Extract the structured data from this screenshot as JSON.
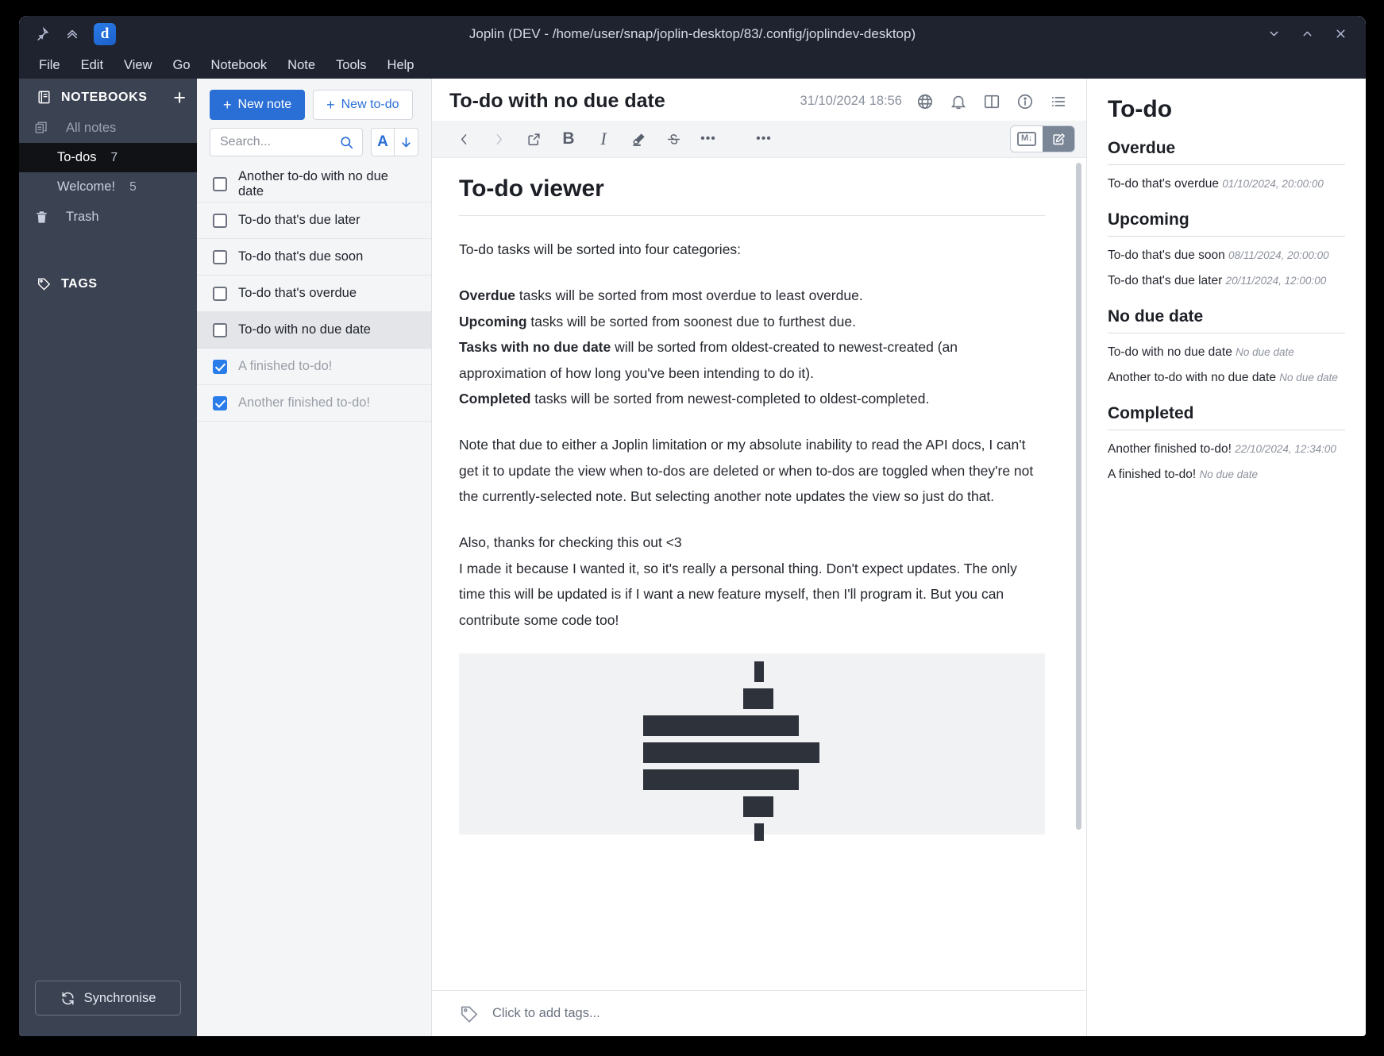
{
  "window": {
    "title": "Joplin (DEV - /home/user/snap/joplin-desktop/83/.config/joplindev-desktop)",
    "pin_icon": "pin-icon",
    "collapse_icon": "chevron-double-up-icon",
    "app_logo": "joplin-logo",
    "minimize_icon": "chevron-down-icon",
    "maximize_icon": "chevron-up-icon",
    "close_icon": "close-icon"
  },
  "menu": {
    "items": [
      {
        "label": "File"
      },
      {
        "label": "Edit"
      },
      {
        "label": "View"
      },
      {
        "label": "Go"
      },
      {
        "label": "Notebook"
      },
      {
        "label": "Note"
      },
      {
        "label": "Tools"
      },
      {
        "label": "Help"
      }
    ]
  },
  "sidebar": {
    "notebooks_header": "NOTEBOOKS",
    "notebooks_icon": "notebook-icon",
    "add_icon": "plus-icon",
    "items": [
      {
        "label": "All notes",
        "count": "",
        "icon": "all-notes-icon",
        "selected": false,
        "dim": true
      },
      {
        "label": "To-dos",
        "count": "7",
        "icon": "",
        "selected": true,
        "dim": false
      },
      {
        "label": "Welcome!",
        "count": "5",
        "icon": "",
        "selected": false,
        "dim": false
      },
      {
        "label": "Trash",
        "count": "",
        "icon": "trash-icon",
        "selected": false,
        "dim": false
      }
    ],
    "tags_header": "TAGS",
    "tags_icon": "tag-icon",
    "sync_label": "Synchronise",
    "sync_icon": "sync-icon"
  },
  "notelist": {
    "new_note_label": "New note",
    "new_todo_label": "New to-do",
    "search_placeholder": "Search...",
    "search_icon": "search-icon",
    "sort_field_label": "A",
    "sort_direction_icon": "arrow-down-icon",
    "items": [
      {
        "title": "Another to-do with no due date",
        "checked": false,
        "selected": false
      },
      {
        "title": "To-do that's due later",
        "checked": false,
        "selected": false
      },
      {
        "title": "To-do that's due soon",
        "checked": false,
        "selected": false
      },
      {
        "title": "To-do that's overdue",
        "checked": false,
        "selected": false
      },
      {
        "title": "To-do with no due date",
        "checked": false,
        "selected": true
      },
      {
        "title": "A finished to-do!",
        "checked": true,
        "selected": false
      },
      {
        "title": "Another finished to-do!",
        "checked": true,
        "selected": false
      }
    ]
  },
  "editor": {
    "note_title": "To-do with no due date",
    "updated": "31/10/2024 18:56",
    "header_icons": [
      {
        "name": "globe-icon"
      },
      {
        "name": "alarm-icon"
      },
      {
        "name": "split-layout-icon"
      },
      {
        "name": "info-icon"
      },
      {
        "name": "list-menu-icon"
      }
    ],
    "toolbar": [
      {
        "name": "back-icon",
        "glyph": "‹",
        "disabled": false
      },
      {
        "name": "forward-icon",
        "glyph": "›",
        "disabled": true
      },
      {
        "name": "external-link-icon",
        "glyph": "",
        "disabled": false
      },
      {
        "name": "bold-icon",
        "glyph": "B",
        "disabled": false
      },
      {
        "name": "italic-icon",
        "glyph": "I",
        "disabled": false
      },
      {
        "name": "highlight-icon",
        "glyph": "",
        "disabled": false
      },
      {
        "name": "strikethrough-icon",
        "glyph": "S",
        "disabled": false
      },
      {
        "name": "more-options-icon",
        "glyph": "•••",
        "disabled": false
      },
      {
        "name": "more-plugins-icon",
        "glyph": "•••",
        "disabled": false
      }
    ],
    "markdown_toggle_label": "M",
    "editor_toggle_icon": "pencil-square-icon",
    "document": {
      "heading": "To-do viewer",
      "intro": "To-do tasks will be sorted into four categories:",
      "categories": [
        {
          "bold": "Overdue",
          "rest": " tasks will be sorted from most overdue to least overdue."
        },
        {
          "bold": "Upcoming",
          "rest": " tasks will be sorted from soonest due to furthest due."
        },
        {
          "bold": "Tasks with no due date",
          "rest": " will be sorted from oldest-created to newest-created (an approximation of how long you've been intending to do it)."
        },
        {
          "bold": "Completed",
          "rest": " tasks will be sorted from newest-completed to oldest-completed."
        }
      ],
      "paragraph2": "Note that due to either a Joplin limitation or my absolute inability to read the API docs, I can't get it to update the view when to-dos are deleted or when to-dos are toggled when they're not the currently-selected note. But selecting another note updates the view so just do that.",
      "paragraph3_line1": "Also, thanks for checking this out <3",
      "paragraph3_line2": "I made it because I wanted it, so it's really a personal thing. Don't expect updates. The only time this will be updated is if I want a new feature myself, then I'll program it. But you can contribute some code too!"
    },
    "tagbar_label": "Click to add tags...",
    "tagbar_icon": "tag-icon"
  },
  "todo_panel": {
    "title": "To-do",
    "sections": [
      {
        "heading": "Overdue",
        "rows": [
          {
            "title": "To-do that's overdue",
            "meta": "01/10/2024, 20:00:00"
          }
        ]
      },
      {
        "heading": "Upcoming",
        "rows": [
          {
            "title": "To-do that's due soon",
            "meta": "08/11/2024, 20:00:00"
          },
          {
            "title": "To-do that's due later",
            "meta": "20/11/2024, 12:00:00"
          }
        ]
      },
      {
        "heading": "No due date",
        "rows": [
          {
            "title": "To-do with no due date",
            "meta": "No due date"
          },
          {
            "title": "Another to-do with no due date",
            "meta": "No due date"
          }
        ]
      },
      {
        "heading": "Completed",
        "rows": [
          {
            "title": "Another finished to-do!",
            "meta": "22/10/2024, 12:34:00"
          },
          {
            "title": "A finished to-do!",
            "meta": "No due date"
          }
        ]
      }
    ]
  },
  "colors": {
    "accent": "#2a6fd6",
    "sidebar_bg": "#3b4252",
    "titlebar_bg": "#1f2330",
    "selected_row": "#101216"
  }
}
